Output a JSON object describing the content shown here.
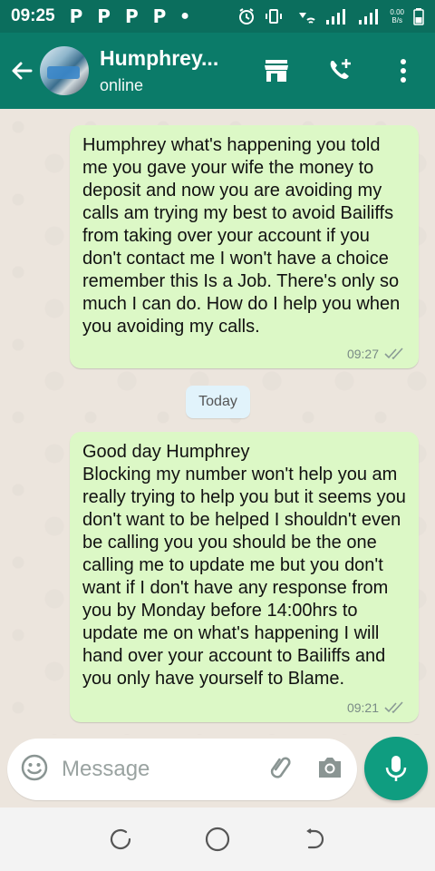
{
  "status_bar": {
    "time": "09:25",
    "notification_icons": [
      "P",
      "P",
      "P",
      "P"
    ],
    "net_speed_value": "0.00",
    "net_speed_unit": "B/s"
  },
  "header": {
    "contact_name": "Humphrey...",
    "contact_status": "online"
  },
  "messages": [
    {
      "text": "Humphrey what's happening you told me you gave your wife the money to deposit and now you are avoiding my calls am trying my best to avoid Bailiffs from taking over your account if you don't contact me I won't have a choice remember this Is a Job. There's only so much I can do. How do I help you when you avoiding my calls.",
      "time": "09:27",
      "status": "delivered"
    },
    {
      "text": "Good day Humphrey\nBlocking my number won't help you am really trying to help you but it seems you don't want to be helped I shouldn't even be calling you you should be the one calling me to update me but you don't want if I don't have any response from you by Monday before 14:00hrs to update me on what's happening I will hand over your account to Bailiffs and you only have yourself to Blame.",
      "time": "09:21",
      "status": "delivered"
    }
  ],
  "date_separator": "Today",
  "composer": {
    "placeholder": "Message"
  },
  "colors": {
    "header": "#0b7b69",
    "status_bar": "#0b6e5d",
    "outgoing_bubble": "#dcf8c6",
    "mic_button": "#0f9d80"
  }
}
